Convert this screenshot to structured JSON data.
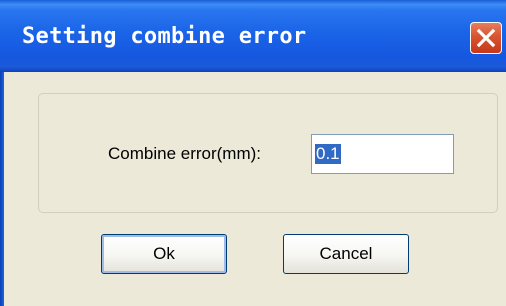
{
  "dialog": {
    "title": "Setting combine error",
    "close_icon": "close-icon"
  },
  "form": {
    "label": "Combine error(mm):",
    "value": "0.1"
  },
  "buttons": {
    "ok_label": "Ok",
    "cancel_label": "Cancel"
  },
  "colors": {
    "titlebar": "#2a76ef",
    "dialog_bg": "#ece9d8",
    "close_button": "#d8542f",
    "selection": "#316ac5"
  }
}
